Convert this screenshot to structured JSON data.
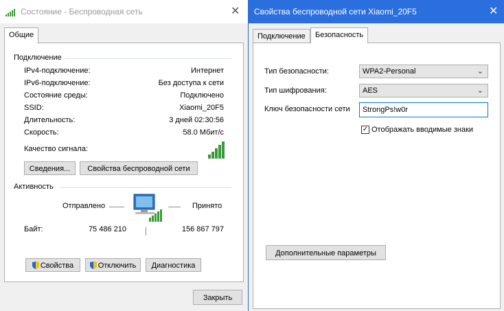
{
  "left_window": {
    "title": "Состояние - Беспроводная сеть",
    "tab": "Общие",
    "connection": {
      "header": "Подключение",
      "rows": [
        {
          "label": "IPv4-подключение:",
          "value": "Интернет"
        },
        {
          "label": "IPv6-подключение:",
          "value": "Без доступа к сети"
        },
        {
          "label": "Состояние среды:",
          "value": "Подключено"
        },
        {
          "label": "SSID:",
          "value": "Xiaomi_20F5"
        },
        {
          "label": "Длительность:",
          "value": "3 дней 02:30:56"
        },
        {
          "label": "Скорость:",
          "value": "58.0 Мбит/с"
        }
      ],
      "signal_label": "Качество сигнала:",
      "signal_bars": 5,
      "details_button": "Сведения...",
      "wireless_props_button": "Свойства беспроводной сети"
    },
    "activity": {
      "header": "Активность",
      "sent_label": "Отправлено",
      "received_label": "Принято",
      "bytes_label": "Байт:",
      "sent_bytes": "75 486 210",
      "received_bytes": "156 867 797"
    },
    "buttons": {
      "properties": "Свойства",
      "disconnect": "Отключить",
      "diagnostics": "Диагностика",
      "close": "Закрыть"
    },
    "close_glyph": "✕"
  },
  "right_window": {
    "title": "Свойства беспроводной сети Xiaomi_20F5",
    "close_glyph": "✕",
    "tabs": [
      "Подключение",
      "Безопасность"
    ],
    "active_tab": "Безопасность",
    "security_type_label": "Тип безопасности:",
    "security_type_value": "WPA2-Personal",
    "encryption_label": "Тип шифрования:",
    "encryption_value": "AES",
    "key_label": "Ключ безопасности сети",
    "key_value": "StrongPs!w0r",
    "show_chars_label": "Отображать вводимые знаки",
    "show_chars_checked": true,
    "advanced_button": "Дополнительные параметры"
  },
  "colors": {
    "accent_title": "#2b6ede",
    "signal_green": "#3a9a3a",
    "input_border": "#0078d7"
  }
}
